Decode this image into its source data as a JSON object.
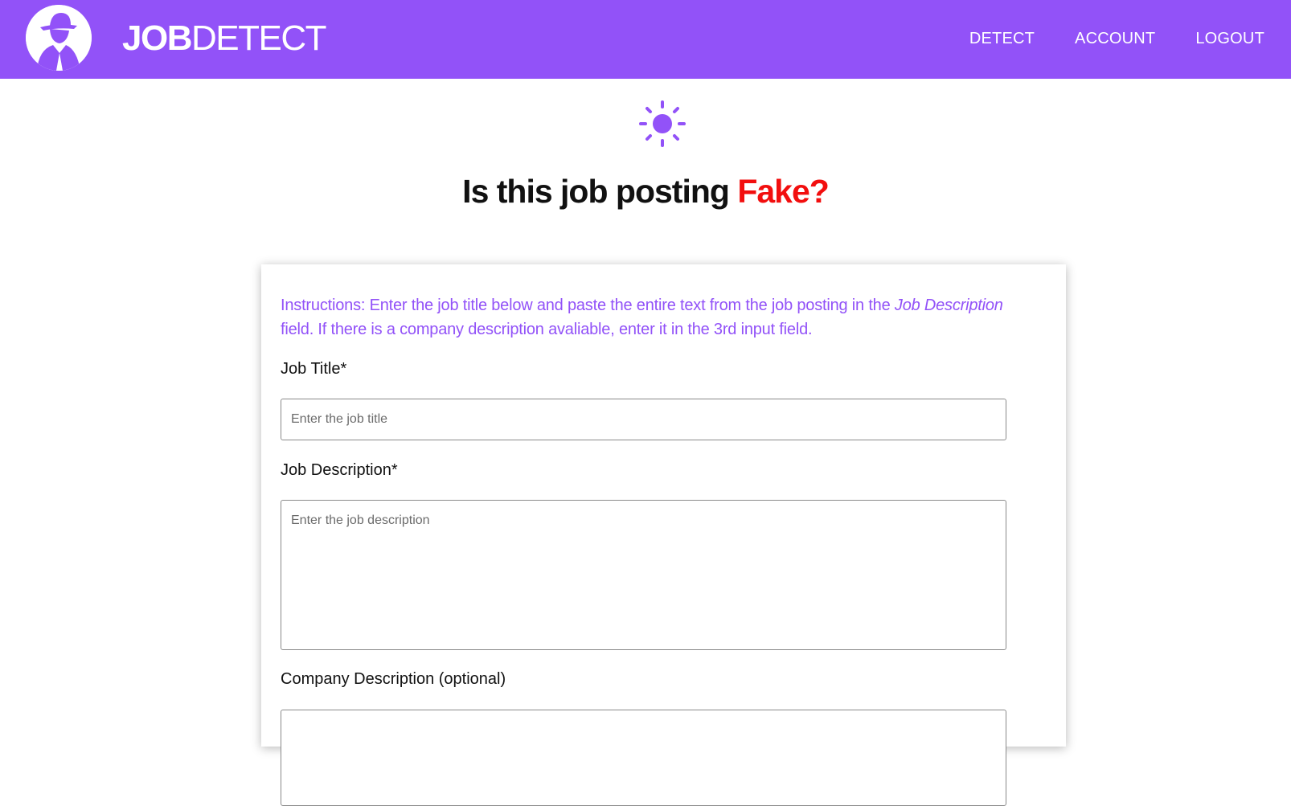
{
  "header": {
    "logo_alt": "spy silhouette logo",
    "brand_bold": "JOB",
    "brand_light": "DETECT",
    "nav": [
      {
        "label": "DETECT"
      },
      {
        "label": "ACCOUNT"
      },
      {
        "label": "LOGOUT"
      }
    ]
  },
  "hero": {
    "icon": "sun-icon",
    "title_prefix": "Is this job posting ",
    "title_highlight": "Fake?"
  },
  "form": {
    "instructions": {
      "part1": "Instructions: Enter the job title below and paste the entire text from the job posting in the ",
      "emphasis": "Job Description",
      "part2": " field. If there is a company description avaliable, enter it in the 3rd input field."
    },
    "job_title": {
      "label": "Job Title*",
      "placeholder": "Enter the job title",
      "value": ""
    },
    "job_description": {
      "label": "Job Description*",
      "placeholder": "Enter the job description",
      "value": ""
    },
    "company_description": {
      "label": "Company Description (optional)",
      "placeholder": "",
      "value": ""
    }
  },
  "colors": {
    "brand_purple": "#9252f8",
    "fake_red": "#f20e0e",
    "text_dark": "#111111"
  }
}
